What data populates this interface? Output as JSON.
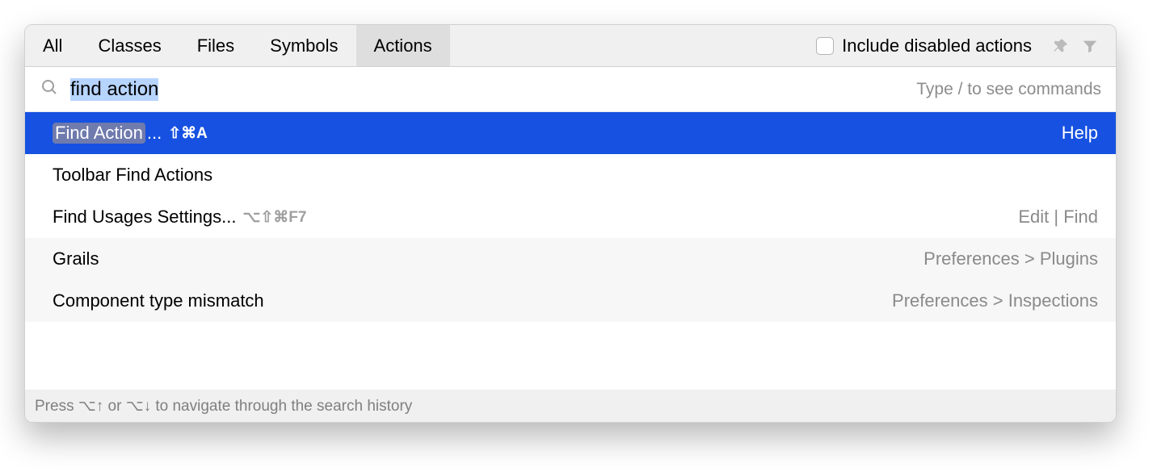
{
  "tabs": {
    "all": "All",
    "classes": "Classes",
    "files": "Files",
    "symbols": "Symbols",
    "actions": "Actions"
  },
  "toolbar": {
    "include_disabled_label": "Include disabled actions"
  },
  "search": {
    "value": "find action",
    "hint": "Type / to see commands"
  },
  "results": [
    {
      "highlight": "Find Action",
      "suffix": "...",
      "shortcut": "⇧⌘A",
      "path": "Help"
    },
    {
      "label": "Toolbar Find Actions",
      "shortcut": "",
      "path": ""
    },
    {
      "label": "Find Usages Settings...",
      "shortcut": "⌥⇧⌘F7",
      "path": "Edit | Find"
    },
    {
      "label": "Grails",
      "shortcut": "",
      "path": "Preferences > Plugins"
    },
    {
      "label": "Component type mismatch",
      "shortcut": "",
      "path": "Preferences > Inspections"
    }
  ],
  "status": "Press ⌥↑ or ⌥↓ to navigate through the search history"
}
